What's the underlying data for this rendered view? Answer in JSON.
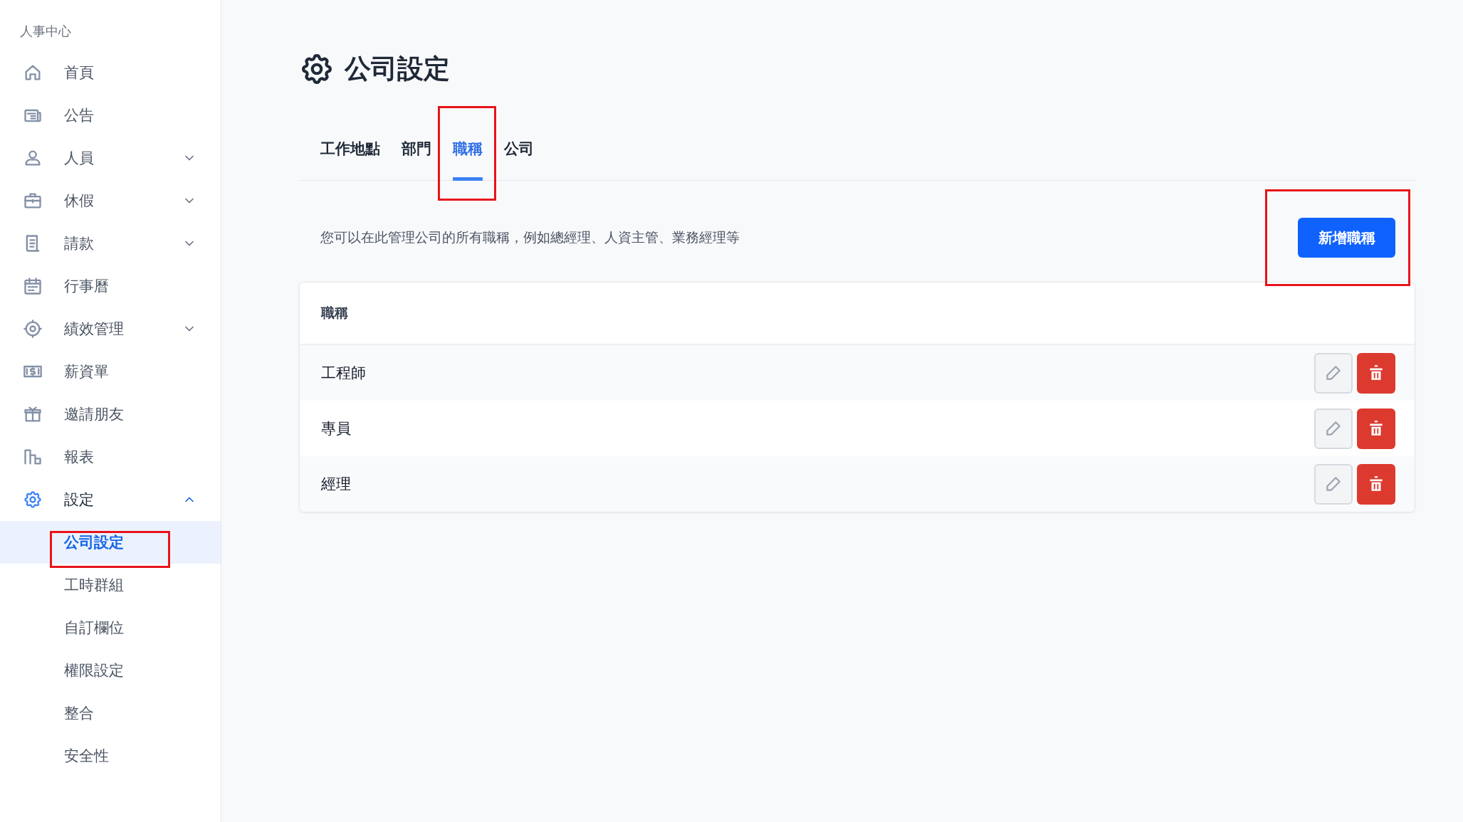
{
  "sidebar": {
    "title": "人事中心",
    "items": [
      {
        "label": "首頁",
        "selected": false
      },
      {
        "label": "公告",
        "selected": false
      },
      {
        "label": "人員",
        "selected": false,
        "expanded": false
      },
      {
        "label": "休假",
        "selected": false,
        "expanded": false
      },
      {
        "label": "請款",
        "selected": false,
        "expanded": false
      },
      {
        "label": "行事曆",
        "selected": false
      },
      {
        "label": "績效管理",
        "selected": false,
        "expanded": false
      },
      {
        "label": "薪資單",
        "selected": false
      },
      {
        "label": "邀請朋友",
        "selected": false
      },
      {
        "label": "報表",
        "selected": false
      },
      {
        "label": "設定",
        "selected": true,
        "expanded": true,
        "children": [
          {
            "label": "公司設定",
            "selected": true,
            "highlighted": true
          },
          {
            "label": "工時群組",
            "selected": false,
            "highlighted": false
          },
          {
            "label": "自訂欄位",
            "selected": false,
            "highlighted": false
          },
          {
            "label": "權限設定",
            "selected": false,
            "highlighted": false
          },
          {
            "label": "整合",
            "selected": false,
            "highlighted": false
          },
          {
            "label": "安全性",
            "selected": false,
            "highlighted": false
          }
        ]
      }
    ]
  },
  "page": {
    "title": "公司設定",
    "tabs": [
      {
        "label": "工作地點",
        "selected": false,
        "highlighted": false
      },
      {
        "label": "部門",
        "selected": false,
        "highlighted": false
      },
      {
        "label": "職稱",
        "selected": true,
        "highlighted": true
      },
      {
        "label": "公司",
        "selected": false,
        "highlighted": false
      }
    ],
    "description": "您可以在此管理公司的所有職稱，例如總經理、人資主管、業務經理等",
    "add_button": {
      "label": "新增職稱",
      "highlighted": true
    },
    "table": {
      "columns": [
        "職稱"
      ],
      "rows": [
        {
          "title": "工程師"
        },
        {
          "title": "專員"
        },
        {
          "title": "經理"
        }
      ]
    }
  }
}
